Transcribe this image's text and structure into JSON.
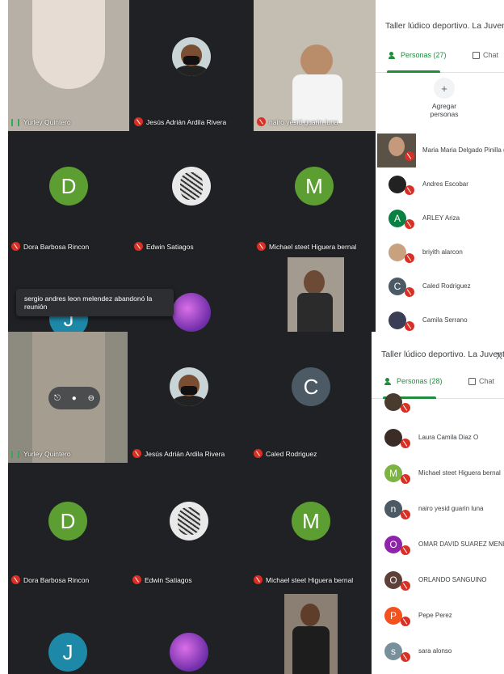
{
  "shot1": {
    "tiles": [
      {
        "name": "Yurley Quintero",
        "mic": "on"
      },
      {
        "name": "Jesús Adrián Ardila Rivera",
        "mic": "off"
      },
      {
        "name": "nairo yesid guarin luna",
        "mic": "off"
      },
      {
        "name": "Dora Barbosa Rincon",
        "mic": "off",
        "initial": "D"
      },
      {
        "name": "Edwin Satiagos",
        "mic": "off"
      },
      {
        "name": "Michael steet Higuera bernal",
        "mic": "off",
        "initial": "M"
      },
      {
        "initial": "J"
      }
    ],
    "notice": "sergio andres leon melendez abandonó la reunión",
    "panel": {
      "title": "Taller lúdico deportivo. La Juvent...",
      "people_tab": "Personas (27)",
      "chat_tab": "Chat",
      "add_label": "Agregar personas",
      "people": [
        {
          "name": "Maria Maria Delgado Pinilla (Tú)",
          "avatar": "photo"
        },
        {
          "name": "Andres Escobar",
          "avatar": "photo"
        },
        {
          "name": "ARLEY Ariza",
          "initial": "A",
          "color": "#0b8043"
        },
        {
          "name": "briyith alarcon",
          "avatar": "photo"
        },
        {
          "name": "Caled Rodriguez",
          "initial": "C",
          "color": "#4c5a65"
        },
        {
          "name": "Camila Serrano",
          "avatar": "photo"
        }
      ]
    }
  },
  "shot2": {
    "tiles": [
      {
        "name": "Yurley Quintero",
        "mic": "on"
      },
      {
        "name": "Jesús Adrián Ardila Rivera",
        "mic": "off"
      },
      {
        "name": "Caled Rodriguez",
        "mic": "off",
        "initial": "C"
      },
      {
        "name": "Dora Barbosa Rincon",
        "mic": "off",
        "initial": "D"
      },
      {
        "name": "Edwin Satiagos",
        "mic": "off"
      },
      {
        "name": "Michael steet Higuera bernal",
        "mic": "off",
        "initial": "M"
      },
      {
        "initial": "J"
      }
    ],
    "panel": {
      "title": "Taller lúdico deportivo. La Juvent...",
      "close": "X",
      "people_tab": "Personas (28)",
      "chat_tab": "Chat",
      "people": [
        {
          "name": "Laura Camila Diaz O",
          "avatar": "photo"
        },
        {
          "name": "Michael steet Higuera bernal",
          "initial": "M",
          "color": "#7cb342"
        },
        {
          "name": "nairo yesid guarin luna",
          "initial": "n",
          "color": "#4c5a65"
        },
        {
          "name": "OMAR DAVID SUAREZ MENDOZA",
          "initial": "O",
          "color": "#8e24aa"
        },
        {
          "name": "ORLANDO SANGUINO",
          "initial": "O",
          "color": "#5d4037"
        },
        {
          "name": "Pepe Perez",
          "initial": "P",
          "color": "#f4511e"
        },
        {
          "name": "sara alonso",
          "initial": "s",
          "color": "#78909c"
        }
      ]
    }
  },
  "colors": {
    "accent": "#1e8e3e",
    "mic_off": "#d93025",
    "meeting_bg": "#202124"
  }
}
